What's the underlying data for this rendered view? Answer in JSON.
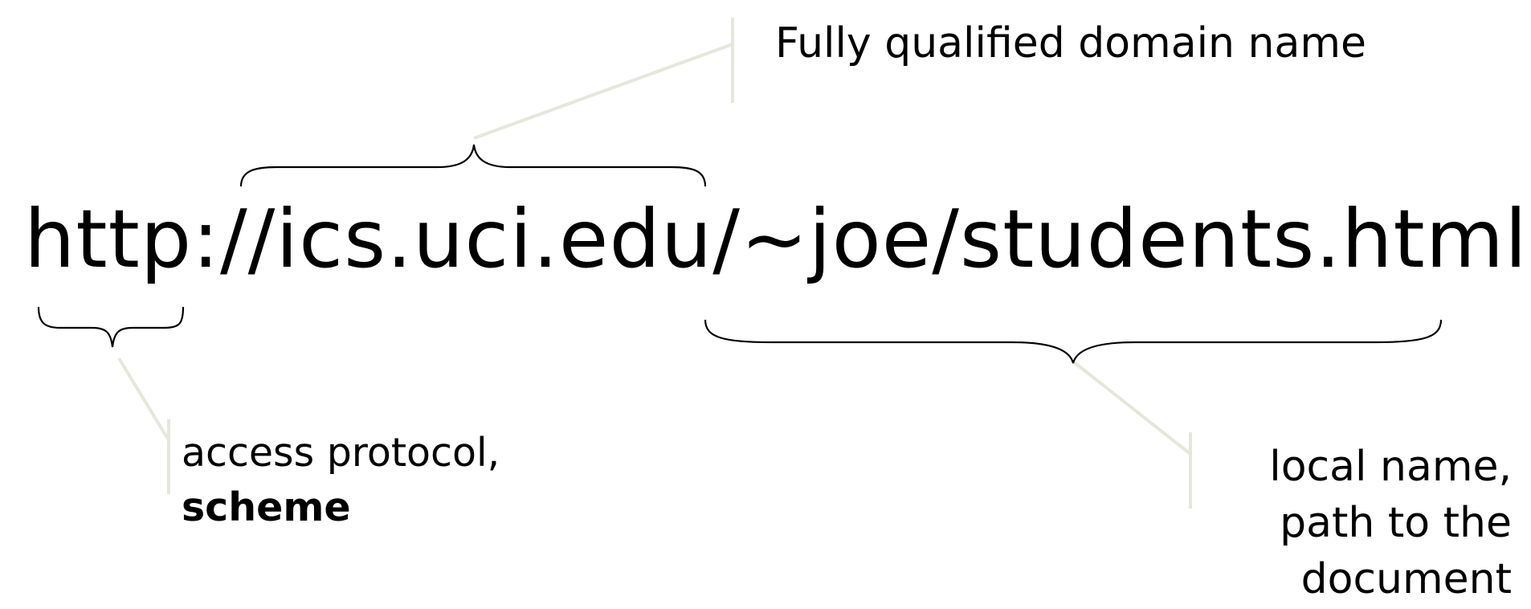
{
  "url": "http://ics.uci.edu/~joe/students.html",
  "labels": {
    "fqdn": "Fully qualified domain name",
    "scheme_line1": "access protocol,",
    "scheme_line2": "scheme",
    "local_line1": "local name,",
    "local_line2": "path to the",
    "local_line3": "document"
  },
  "colors": {
    "text": "#000000",
    "brace": "#000000",
    "leader": "#e6e6dc",
    "background": "#ffffff"
  }
}
